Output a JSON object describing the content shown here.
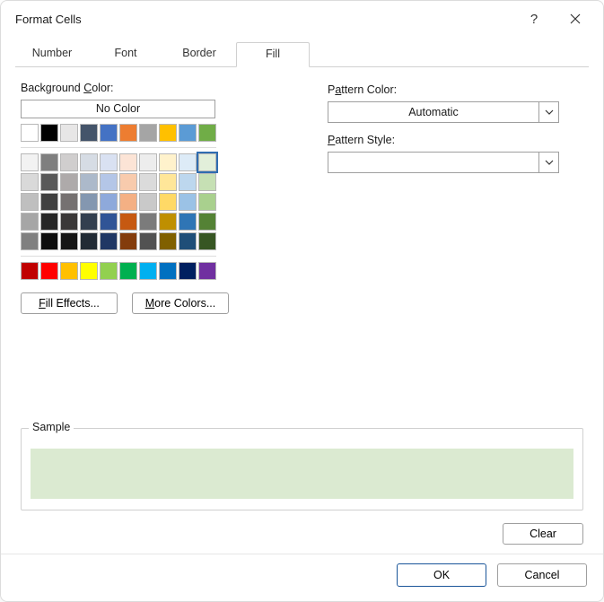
{
  "window": {
    "title": "Format Cells"
  },
  "tabs": [
    {
      "label": "Number",
      "active": false
    },
    {
      "label": "Font",
      "active": false
    },
    {
      "label": "Border",
      "active": false
    },
    {
      "label": "Fill",
      "active": true
    }
  ],
  "fill": {
    "background_label": "Background Color:",
    "no_color_label": "No Color",
    "theme_colors": [
      "#FFFFFF",
      "#000000",
      "#E7E6E6",
      "#44546A",
      "#4472C4",
      "#ED7D31",
      "#A5A5A5",
      "#FFC000",
      "#5B9BD5",
      "#70AD47"
    ],
    "shade_rows": [
      [
        "#F2F2F2",
        "#7F7F7F",
        "#D0CECE",
        "#D6DCE4",
        "#D9E1F2",
        "#FCE4D6",
        "#EDEDED",
        "#FFF2CC",
        "#DDEBF7",
        "#E2EFDA"
      ],
      [
        "#D9D9D9",
        "#595959",
        "#AEAAAA",
        "#ACB9CA",
        "#B4C6E7",
        "#F8CBAD",
        "#DBDBDB",
        "#FFE699",
        "#BDD7EE",
        "#C6E0B4"
      ],
      [
        "#BFBFBF",
        "#404040",
        "#757171",
        "#8497B0",
        "#8EA9DB",
        "#F4B084",
        "#C9C9C9",
        "#FFD966",
        "#9BC2E6",
        "#A9D08E"
      ],
      [
        "#A6A6A6",
        "#262626",
        "#3A3838",
        "#333F4F",
        "#305496",
        "#C65911",
        "#7B7B7B",
        "#BF8F00",
        "#2F75B5",
        "#548235"
      ],
      [
        "#808080",
        "#0D0D0D",
        "#161616",
        "#222B35",
        "#203764",
        "#833C0C",
        "#525252",
        "#806000",
        "#1F4E78",
        "#375623"
      ]
    ],
    "standard_colors": [
      "#C00000",
      "#FF0000",
      "#FFC000",
      "#FFFF00",
      "#92D050",
      "#00B050",
      "#00B0F0",
      "#0070C0",
      "#002060",
      "#7030A0"
    ],
    "selected_color": "#E2EFDA",
    "fill_effects_label": "Fill Effects...",
    "more_colors_label": "More Colors...",
    "pattern_color_label": "Pattern Color:",
    "pattern_color_value": "Automatic",
    "pattern_style_label": "Pattern Style:",
    "pattern_style_value": "",
    "sample_label": "Sample",
    "sample_color": "#DBEAD1",
    "clear_label": "Clear"
  },
  "footer": {
    "ok": "OK",
    "cancel": "Cancel"
  }
}
